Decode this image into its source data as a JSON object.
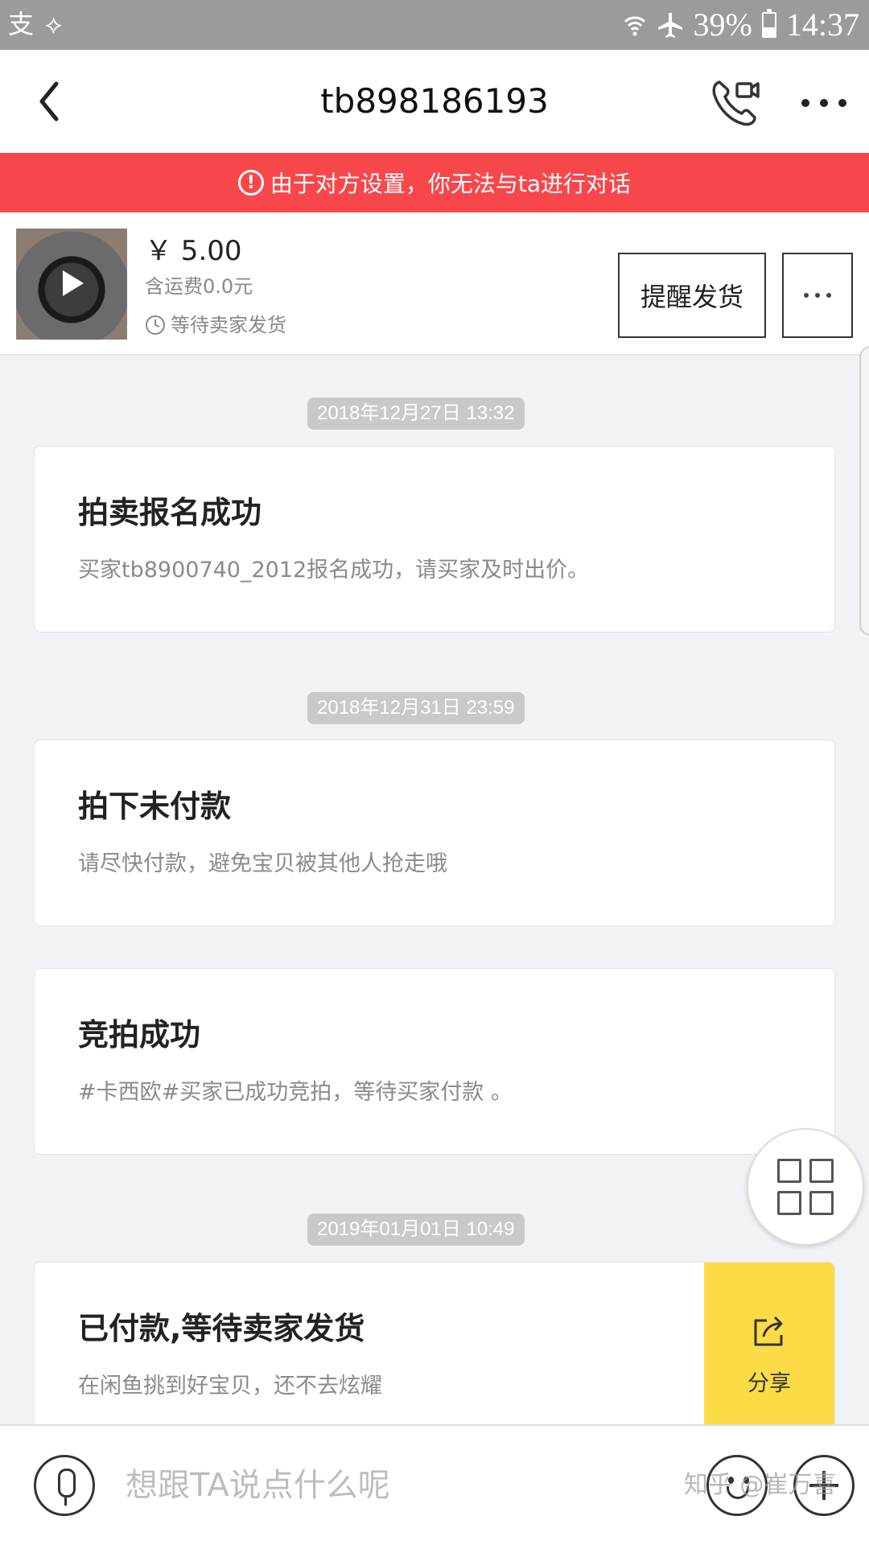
{
  "status_bar": {
    "left_icons": [
      "alipay-icon",
      "notification-icon"
    ],
    "left_glyphs": [
      "支",
      "⟡"
    ],
    "battery": "39%",
    "time": "14:37",
    "icons": [
      "wifi-icon",
      "airplane-mode-icon",
      "battery-icon"
    ]
  },
  "nav": {
    "title": "tb898186193",
    "icons": [
      "back-arrow-icon",
      "video-call-icon",
      "more-dots-icon"
    ]
  },
  "banner": {
    "icon_glyph": "!",
    "text": "由于对方设置，你无法与ta进行对话"
  },
  "product": {
    "price": "￥ 5.00",
    "shipping": "含运费0.0元",
    "status": "等待卖家发货",
    "remind_button": "提醒发货"
  },
  "messages": [
    {
      "timestamp": "2018年12月27日 13:32",
      "title": "拍卖报名成功",
      "desc": "买家tb8900740_2012报名成功，请买家及时出价。"
    },
    {
      "timestamp": "2018年12月31日 23:59",
      "title": "拍下未付款",
      "desc": "请尽快付款，避免宝贝被其他人抢走哦"
    },
    {
      "title": "竞拍成功",
      "desc": "#卡西欧#买家已成功竞拍，等待买家付款 。"
    },
    {
      "timestamp": "2019年01月01日 10:49",
      "title": "已付款,等待卖家发货",
      "desc": "在闲鱼挑到好宝贝，还不去炫耀",
      "share_label": "分享"
    }
  ],
  "input": {
    "placeholder": "想跟TA说点什么呢"
  },
  "watermark": "知乎 @崔万喜",
  "colors": {
    "banner_bg": "#f8474b",
    "share_bg": "#fbdc47",
    "page_bg": "#f1f2f6",
    "timestamp_bg": "#c9c9c9"
  }
}
